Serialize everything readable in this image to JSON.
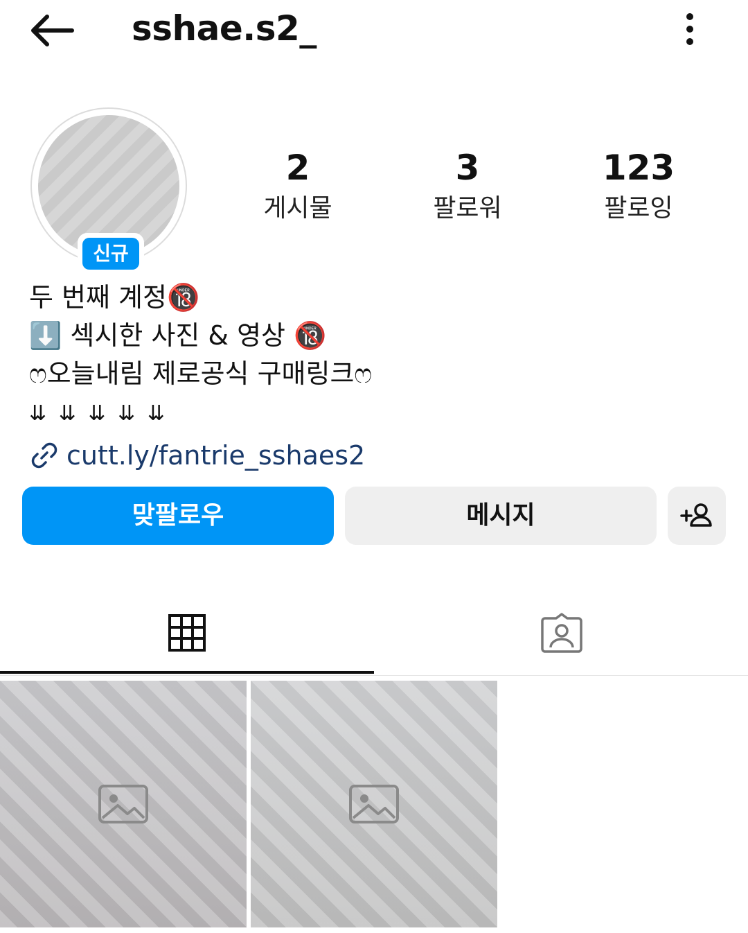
{
  "header": {
    "username": "sshae.s2_",
    "back_icon": "arrow-left-icon",
    "more_icon": "more-vertical-icon"
  },
  "profile": {
    "avatar_icon": "avatar-image",
    "new_badge": "신규",
    "stats": [
      {
        "num": "2",
        "label": "게시물"
      },
      {
        "num": "3",
        "label": "팔로워"
      },
      {
        "num": "123",
        "label": "팔로잉"
      }
    ]
  },
  "bio": {
    "line1": "두 번째 계정🔞",
    "line2": "⬇️ 섹시한 사진 & 영상 🔞",
    "line3": "ෆ오늘내림 제로공식 구매링크ෆ",
    "arrows": "⇊ ⇊ ⇊ ⇊ ⇊",
    "link": "cutt.ly/fantrie_sshaes2"
  },
  "actions": {
    "follow_back": "맞팔로우",
    "message": "메시지",
    "add_person_icon": "add-person-icon"
  },
  "tabs": [
    {
      "icon": "grid-icon",
      "active": true
    },
    {
      "icon": "tagged-person-icon",
      "active": false
    }
  ],
  "posts": [
    {
      "icon": "image-placeholder"
    },
    {
      "icon": "image-placeholder"
    }
  ],
  "colors": {
    "accent": "#0095f6",
    "link": "#1a3a6b",
    "button_gray": "#efefef"
  }
}
